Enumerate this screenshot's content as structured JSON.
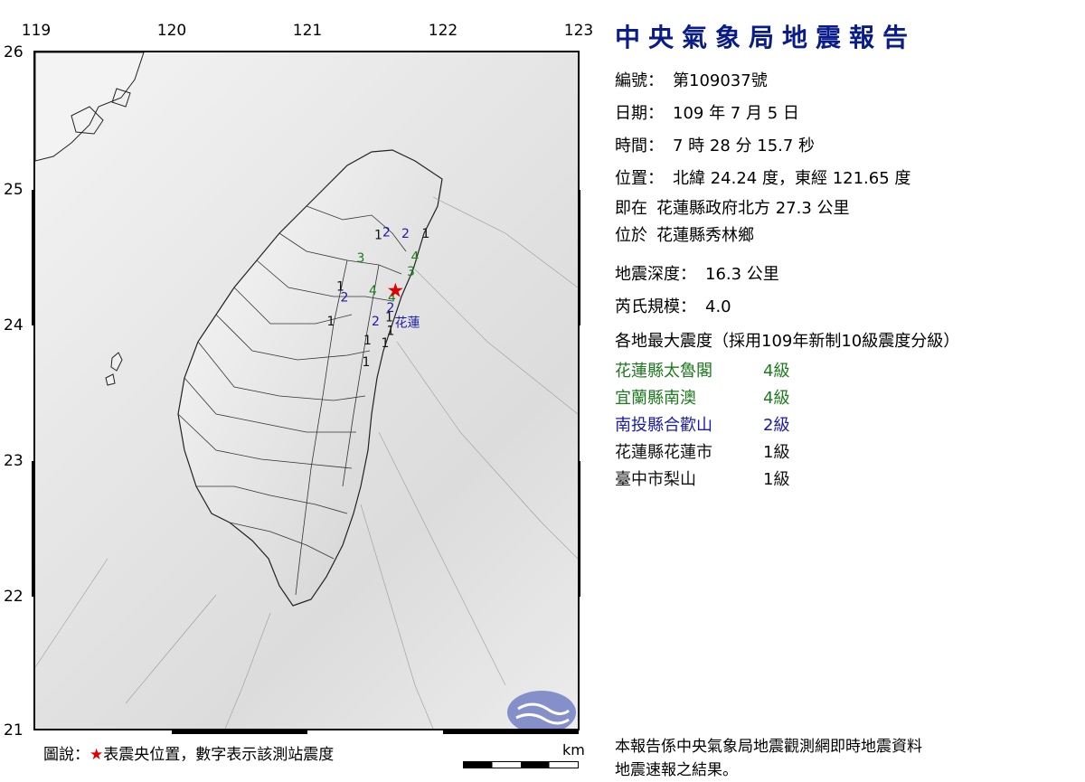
{
  "map": {
    "longitude_labels": [
      "119",
      "120",
      "121",
      "122",
      "123"
    ],
    "latitude_labels": [
      "26",
      "25",
      "24",
      "23",
      "22",
      "21"
    ],
    "epicenter_marker": "red-star",
    "city_label": "花蓮",
    "station_readings": [
      {
        "value": "1",
        "lon": 121.5,
        "lat": 24.62,
        "color": "#111111"
      },
      {
        "value": "2",
        "lon": 121.56,
        "lat": 24.64,
        "color": "#1a1aa8"
      },
      {
        "value": "2",
        "lon": 121.7,
        "lat": 24.63,
        "color": "#1a1aa8"
      },
      {
        "value": "1",
        "lon": 121.85,
        "lat": 24.63,
        "color": "#111111"
      },
      {
        "value": "3",
        "lon": 121.37,
        "lat": 24.45,
        "color": "#1e7a1e"
      },
      {
        "value": "4",
        "lon": 121.77,
        "lat": 24.46,
        "color": "#1e7a1e"
      },
      {
        "value": "3",
        "lon": 121.74,
        "lat": 24.35,
        "color": "#1e7a1e"
      },
      {
        "value": "1",
        "lon": 121.22,
        "lat": 24.24,
        "color": "#111111"
      },
      {
        "value": "4",
        "lon": 121.46,
        "lat": 24.21,
        "color": "#1e7a1e"
      },
      {
        "value": "2",
        "lon": 121.25,
        "lat": 24.16,
        "color": "#1a1aa8"
      },
      {
        "value": "4",
        "lon": 121.6,
        "lat": 24.16,
        "color": "#1e7a1e"
      },
      {
        "value": "2",
        "lon": 121.59,
        "lat": 24.08,
        "color": "#1a1aa8"
      },
      {
        "value": "1",
        "lon": 121.58,
        "lat": 24.01,
        "color": "#111111"
      },
      {
        "value": "2",
        "lon": 121.48,
        "lat": 23.98,
        "color": "#1a1aa8"
      },
      {
        "value": "1",
        "lon": 121.15,
        "lat": 23.98,
        "color": "#111111"
      },
      {
        "value": "1",
        "lon": 121.59,
        "lat": 23.91,
        "color": "#111111"
      },
      {
        "value": "1",
        "lon": 121.42,
        "lat": 23.84,
        "color": "#111111"
      },
      {
        "value": "1",
        "lon": 121.55,
        "lat": 23.82,
        "color": "#111111"
      },
      {
        "value": "1",
        "lon": 121.41,
        "lat": 23.68,
        "color": "#111111"
      }
    ],
    "epicenter": {
      "lon": 121.65,
      "lat": 24.24
    },
    "legend_prefix": "圖說：",
    "legend_star": "★",
    "legend_text": "表震央位置，數字表示該測站震度",
    "scale_unit": "km"
  },
  "report": {
    "title": "中央氣象局地震報告",
    "number_label": "編號：",
    "number_value": "第109037號",
    "date_label": "日期：",
    "date_value": "109 年 7 月 5 日",
    "time_label": "時間：",
    "time_value": "7 時 28 分 15.7 秒",
    "position_label": "位置：",
    "position_value": "北緯 24.24 度，東經 121.65 度",
    "relative_label": "即在",
    "relative_value": "花蓮縣政府北方 27.3 公里",
    "located_label": "位於",
    "located_value": "花蓮縣秀林鄉",
    "depth_label": "地震深度：",
    "depth_value": "16.3 公里",
    "magnitude_label": "芮氏規模：",
    "magnitude_value": "4.0",
    "intensity_heading": "各地最大震度（採用109年新制10級震度分級）",
    "stations": [
      {
        "name": "花蓮縣太魯閣",
        "level": "4級",
        "color": "#1e7a1e"
      },
      {
        "name": "宜蘭縣南澳",
        "level": "4級",
        "color": "#1e7a1e"
      },
      {
        "name": "南投縣合歡山",
        "level": "2級",
        "color": "#1a1aa8"
      },
      {
        "name": "花蓮縣花蓮市",
        "level": "1級",
        "color": "#111111"
      },
      {
        "name": "臺中市梨山",
        "level": "1級",
        "color": "#111111"
      }
    ],
    "footer_line1": "本報告係中央氣象局地震觀測網即時地震資料",
    "footer_line2": "地震速報之結果。"
  },
  "colors": {
    "title_blue": "#0a1b8a",
    "epicenter_red": "#e00000"
  }
}
